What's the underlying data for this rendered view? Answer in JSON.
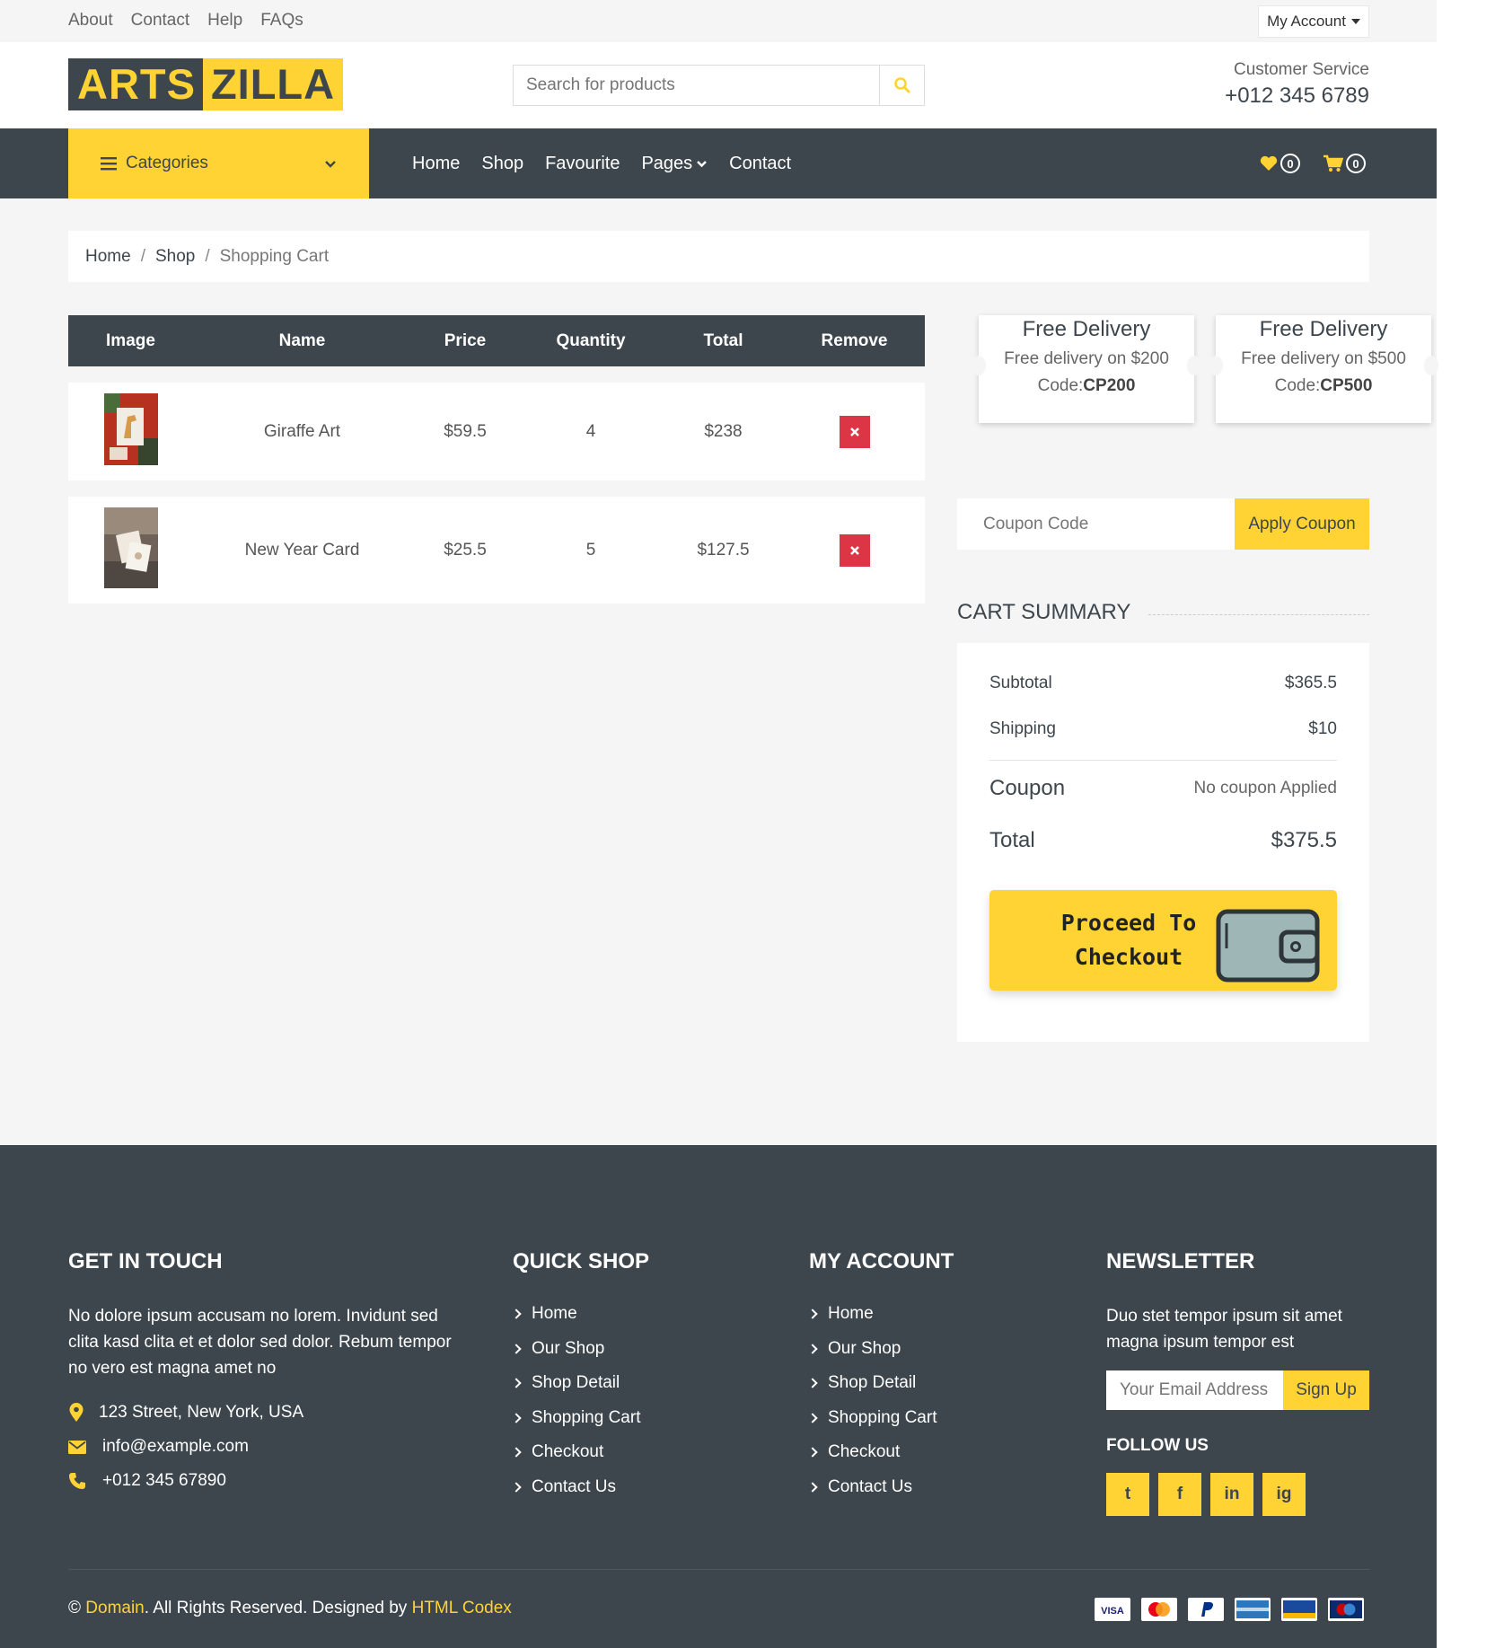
{
  "topbar": {
    "links": [
      "About",
      "Contact",
      "Help",
      "FAQs"
    ],
    "account_label": "My Account"
  },
  "header": {
    "logo_left": "ARTS",
    "logo_right": "ZILLA",
    "search_placeholder": "Search for products",
    "service_label": "Customer Service",
    "service_phone": "+012 345 6789"
  },
  "navbar": {
    "categories_label": "Categories",
    "links": [
      "Home",
      "Shop",
      "Favourite",
      "Pages",
      "Contact"
    ],
    "favourites_count": "0",
    "cart_count": "0"
  },
  "breadcrumb": {
    "items": [
      "Home",
      "Shop"
    ],
    "current": "Shopping Cart"
  },
  "cart": {
    "headers": [
      "Image",
      "Name",
      "Price",
      "Quantity",
      "Total",
      "Remove"
    ],
    "rows": [
      {
        "name": "Giraffe Art",
        "price": "$59.5",
        "quantity": "4",
        "total": "$238"
      },
      {
        "name": "New Year Card",
        "price": "$25.5",
        "quantity": "5",
        "total": "$127.5"
      }
    ]
  },
  "delivery": [
    {
      "title": "Free Delivery",
      "subtitle": "Free delivery on $200",
      "code_label": "Code:",
      "code": "CP200"
    },
    {
      "title": "Free Delivery",
      "subtitle": "Free delivery on $500",
      "code_label": "Code:",
      "code": "CP500"
    }
  ],
  "coupon": {
    "placeholder": "Coupon Code",
    "button": "Apply Coupon"
  },
  "summary": {
    "title": "CART SUMMARY",
    "subtotal_label": "Subtotal",
    "subtotal": "$365.5",
    "shipping_label": "Shipping",
    "shipping": "$10",
    "coupon_label": "Coupon",
    "coupon_value": "No coupon Applied",
    "total_label": "Total",
    "total": "$375.5",
    "checkout_line1": "Proceed To",
    "checkout_line2": "Checkout"
  },
  "footer": {
    "contact": {
      "title": "GET IN TOUCH",
      "description": "No dolore ipsum accusam no lorem. Invidunt sed clita kasd clita et et dolor sed dolor. Rebum tempor no vero est magna amet no",
      "address": "123 Street, New York, USA",
      "email": "info@example.com",
      "phone": "+012 345 67890"
    },
    "quick_shop": {
      "title": "QUICK SHOP",
      "links": [
        "Home",
        "Our Shop",
        "Shop Detail",
        "Shopping Cart",
        "Checkout",
        "Contact Us"
      ]
    },
    "my_account": {
      "title": "MY ACCOUNT",
      "links": [
        "Home",
        "Our Shop",
        "Shop Detail",
        "Shopping Cart",
        "Checkout",
        "Contact Us"
      ]
    },
    "newsletter": {
      "title": "NEWSLETTER",
      "description": "Duo stet tempor ipsum sit amet magna ipsum tempor est",
      "email_placeholder": "Your Email Address",
      "button": "Sign Up",
      "follow_label": "FOLLOW US",
      "social_icons": [
        "twitter-icon",
        "facebook-icon",
        "linkedin-icon",
        "instagram-icon"
      ],
      "social_glyphs": [
        "t",
        "f",
        "in",
        "ig"
      ]
    },
    "copyright_symbol": "©",
    "copyright_domain": "Domain",
    "copyright_mid": ". All Rights Reserved. Designed by",
    "copyright_designer": "HTML Codex",
    "payment_icons": [
      "visa-icon",
      "mastercard-icon",
      "paypal-icon",
      "american-express-icon",
      "visa-electron-icon",
      "maestro-icon"
    ]
  },
  "colors": {
    "accent": "#FFD333",
    "dark": "#3D464D",
    "danger": "#DC3545",
    "background": "#F5F5F5"
  }
}
